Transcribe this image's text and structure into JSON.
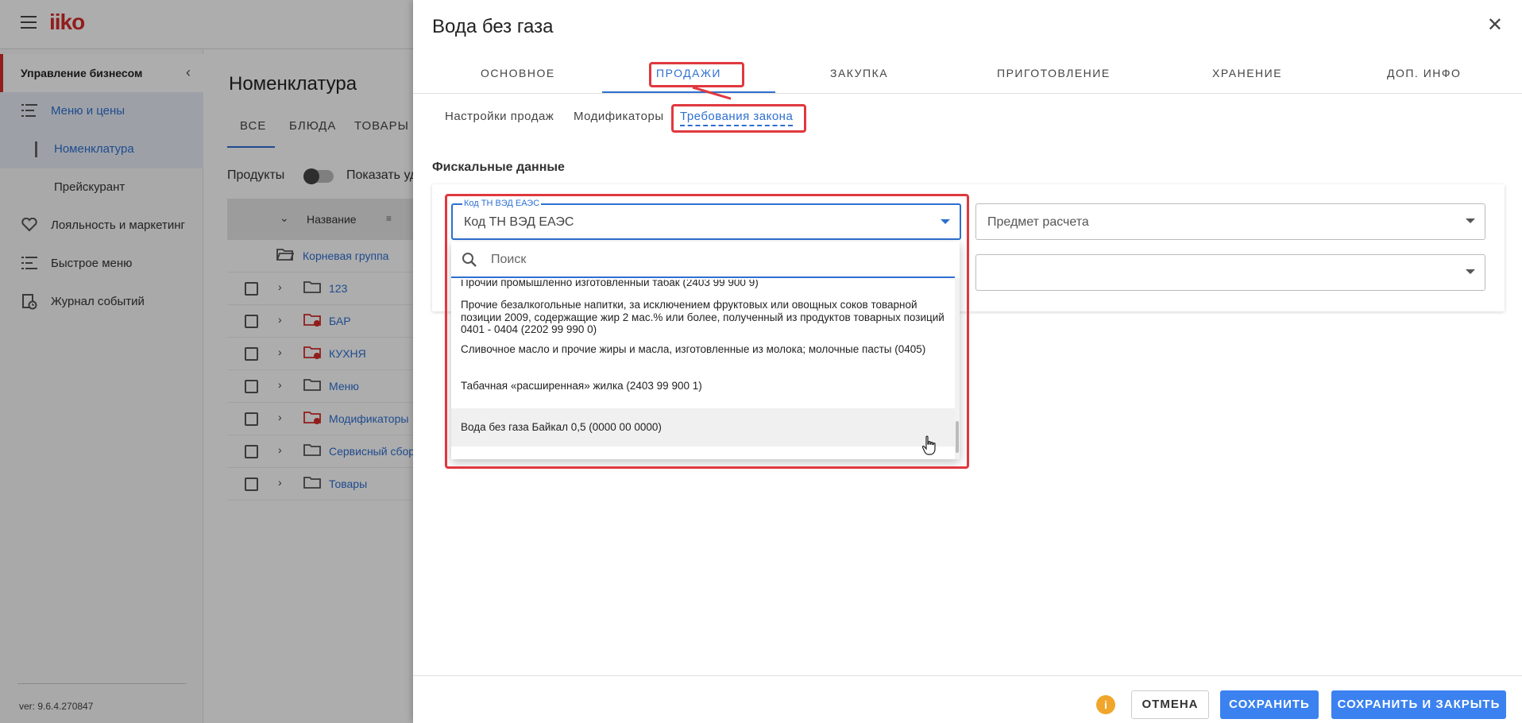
{
  "app": {
    "logo_text": "iiko",
    "version": "ver: 9.6.4.270847"
  },
  "sidebar": {
    "section_title": "Управление бизнесом",
    "items": [
      {
        "label": "Меню и цены",
        "icon": "menu-list-icon"
      },
      {
        "label": "Номенклатура"
      },
      {
        "label": "Прейскурант"
      },
      {
        "label": "Лояльность и маркетинг",
        "icon": "heart-icon"
      },
      {
        "label": "Быстрое меню",
        "icon": "quick-menu-icon"
      },
      {
        "label": "Журнал событий",
        "icon": "journal-icon"
      }
    ]
  },
  "main": {
    "title": "Номенклатура",
    "tabs": [
      "ВСЕ",
      "БЛЮДА",
      "ТОВАРЫ"
    ],
    "products_label": "Продукты",
    "show_deleted_label": "Показать уд",
    "grid_header": "Название",
    "root_group": "Корневая группа",
    "rows": [
      {
        "name": "123",
        "warning": false
      },
      {
        "name": "БАР",
        "warning": true
      },
      {
        "name": "КУХНЯ",
        "warning": true
      },
      {
        "name": "Меню",
        "warning": false
      },
      {
        "name": "Модификаторы",
        "warning": true
      },
      {
        "name": "Сервисный сбор",
        "warning": false
      },
      {
        "name": "Товары",
        "warning": false
      }
    ]
  },
  "dialog": {
    "title": "Вода без газа",
    "tabs": [
      "ОСНОВНОЕ",
      "ПРОДАЖИ",
      "ЗАКУПКА",
      "ПРИГОТОВЛЕНИЕ",
      "ХРАНЕНИЕ",
      "ДОП. ИНФО"
    ],
    "active_tab": "ПРОДАЖИ",
    "subtabs": [
      "Настройки продаж",
      "Модификаторы",
      "Требования закона"
    ],
    "active_subtab": "Требования закона",
    "section_title": "Фискальные данные",
    "tnved_field": {
      "label": "Код ТН ВЭД ЕАЭС",
      "value": "Код ТН ВЭД ЕАЭС"
    },
    "payment_subject_field": {
      "placeholder": "Предмет расчета"
    },
    "dropdown": {
      "search_placeholder": "Поиск",
      "options": [
        "Прочий промышленно изготовленный табак (2403 99 900 9)",
        "Прочие безалкогольные напитки, за исключением фруктовых или овощных соков товарной позиции 2009, содержащие жир 2 мас.% или более, полученный из продуктов товарных позиций 0401 - 0404 (2202 99 990 0)",
        "Сливочное масло и прочие жиры и масла, изготовленные из молока; молочные пасты (0405)",
        "Табачная «расширенная» жилка (2403 99 900 1)",
        "Вода без газа Байкал 0,5 (0000 00 0000)"
      ],
      "hovered_option": "Вода без газа Байкал 0,5 (0000 00 0000)"
    },
    "footer": {
      "info_icon": "i",
      "cancel": "ОТМЕНА",
      "save": "СОХРАНИТЬ",
      "save_close": "СОХРАНИТЬ И ЗАКРЫТЬ"
    }
  },
  "colors": {
    "accent_blue": "#2e6fd1",
    "button_blue": "#3b82f0",
    "highlight_red": "#e0383e",
    "brand_red": "#d62c2c",
    "warning_orange": "#f0a62a"
  }
}
